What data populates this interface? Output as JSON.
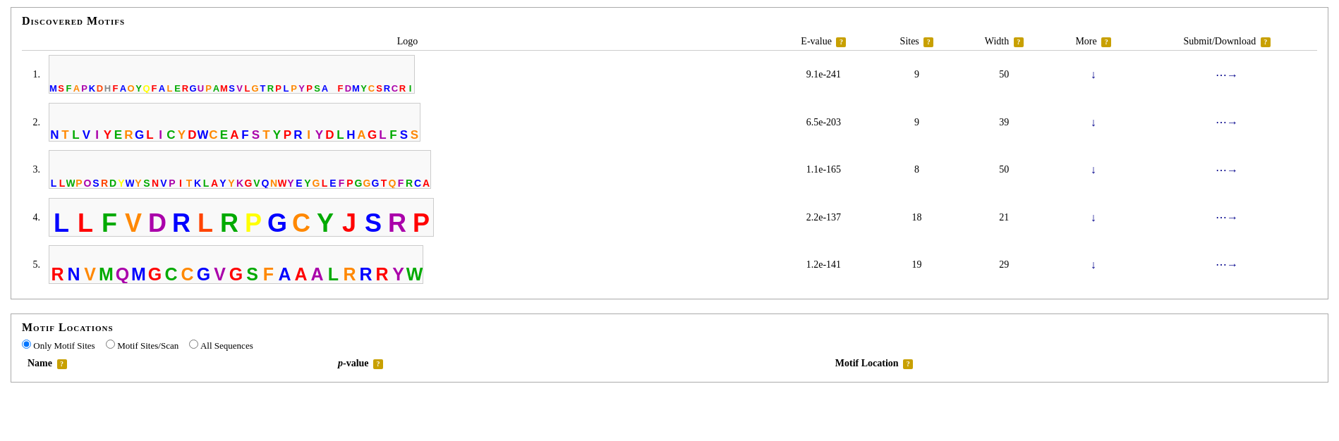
{
  "discovered_motifs": {
    "section_title": "Discovered Motifs",
    "table": {
      "headers": {
        "logo": "Logo",
        "evalue": "E-value",
        "sites": "Sites",
        "width": "Width",
        "more": "More",
        "submit_download": "Submit/Download"
      },
      "rows": [
        {
          "num": "1.",
          "evalue": "9.1e-241",
          "sites": "9",
          "width": "50",
          "logo_color": "#3355cc"
        },
        {
          "num": "2.",
          "evalue": "6.5e-203",
          "sites": "9",
          "width": "39",
          "logo_color": "#22aa44"
        },
        {
          "num": "3.",
          "evalue": "1.1e-165",
          "sites": "8",
          "width": "50",
          "logo_color": "#cc4422"
        },
        {
          "num": "4.",
          "evalue": "2.2e-137",
          "sites": "18",
          "width": "21",
          "logo_color": "#aa22cc"
        },
        {
          "num": "5.",
          "evalue": "1.2e-141",
          "sites": "19",
          "width": "29",
          "logo_color": "#cc8822"
        }
      ]
    }
  },
  "motif_locations": {
    "section_title": "Motif Locations",
    "radio_options": [
      {
        "label": "Only Motif Sites",
        "value": "only",
        "checked": true
      },
      {
        "label": "Motif Sites/Scan",
        "value": "scan",
        "checked": false
      },
      {
        "label": "All Sequences",
        "value": "all",
        "checked": false
      }
    ],
    "table_headers": {
      "name": "Name",
      "pvalue": "p-value",
      "motif_location": "Motif Location"
    }
  },
  "icons": {
    "help": "?",
    "download": "↓",
    "arrow": "→"
  }
}
